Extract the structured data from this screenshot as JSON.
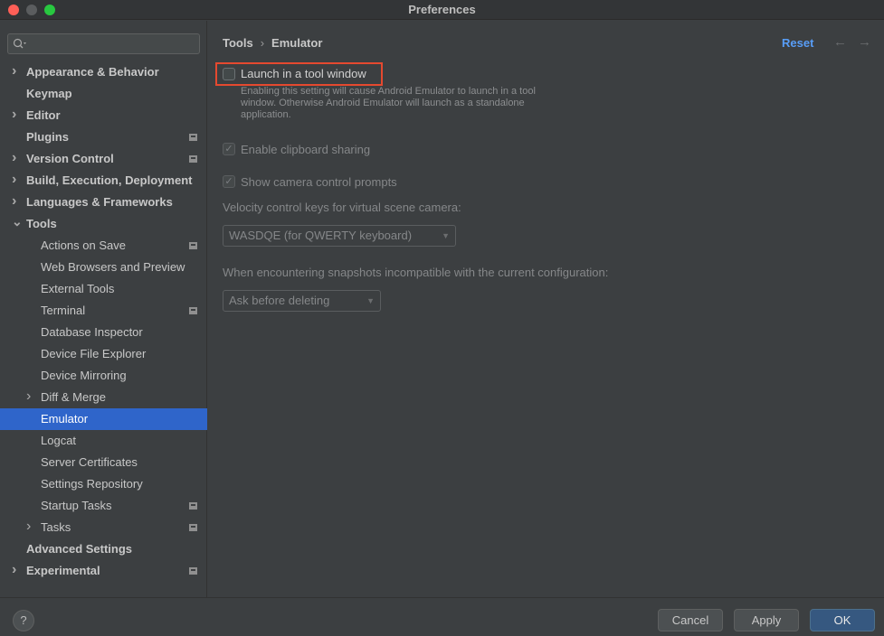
{
  "window": {
    "title": "Preferences"
  },
  "search": {
    "placeholder": ""
  },
  "tree": [
    {
      "label": "Appearance & Behavior",
      "level": 0,
      "chevron": "right",
      "bold": true,
      "project_icon": false,
      "selected": false
    },
    {
      "label": "Keymap",
      "level": 0,
      "chevron": "",
      "bold": true,
      "project_icon": false,
      "selected": false
    },
    {
      "label": "Editor",
      "level": 0,
      "chevron": "right",
      "bold": true,
      "project_icon": false,
      "selected": false
    },
    {
      "label": "Plugins",
      "level": 0,
      "chevron": "",
      "bold": true,
      "project_icon": true,
      "selected": false
    },
    {
      "label": "Version Control",
      "level": 0,
      "chevron": "right",
      "bold": true,
      "project_icon": true,
      "selected": false
    },
    {
      "label": "Build, Execution, Deployment",
      "level": 0,
      "chevron": "right",
      "bold": true,
      "project_icon": false,
      "selected": false
    },
    {
      "label": "Languages & Frameworks",
      "level": 0,
      "chevron": "right",
      "bold": true,
      "project_icon": false,
      "selected": false
    },
    {
      "label": "Tools",
      "level": 0,
      "chevron": "down",
      "bold": true,
      "project_icon": false,
      "selected": false
    },
    {
      "label": "Actions on Save",
      "level": 1,
      "chevron": "",
      "bold": false,
      "project_icon": true,
      "selected": false
    },
    {
      "label": "Web Browsers and Preview",
      "level": 1,
      "chevron": "",
      "bold": false,
      "project_icon": false,
      "selected": false
    },
    {
      "label": "External Tools",
      "level": 1,
      "chevron": "",
      "bold": false,
      "project_icon": false,
      "selected": false
    },
    {
      "label": "Terminal",
      "level": 1,
      "chevron": "",
      "bold": false,
      "project_icon": true,
      "selected": false
    },
    {
      "label": "Database Inspector",
      "level": 1,
      "chevron": "",
      "bold": false,
      "project_icon": false,
      "selected": false
    },
    {
      "label": "Device File Explorer",
      "level": 1,
      "chevron": "",
      "bold": false,
      "project_icon": false,
      "selected": false
    },
    {
      "label": "Device Mirroring",
      "level": 1,
      "chevron": "",
      "bold": false,
      "project_icon": false,
      "selected": false
    },
    {
      "label": "Diff & Merge",
      "level": 1,
      "chevron": "right",
      "bold": false,
      "project_icon": false,
      "selected": false
    },
    {
      "label": "Emulator",
      "level": 1,
      "chevron": "",
      "bold": false,
      "project_icon": false,
      "selected": true
    },
    {
      "label": "Logcat",
      "level": 1,
      "chevron": "",
      "bold": false,
      "project_icon": false,
      "selected": false
    },
    {
      "label": "Server Certificates",
      "level": 1,
      "chevron": "",
      "bold": false,
      "project_icon": false,
      "selected": false
    },
    {
      "label": "Settings Repository",
      "level": 1,
      "chevron": "",
      "bold": false,
      "project_icon": false,
      "selected": false
    },
    {
      "label": "Startup Tasks",
      "level": 1,
      "chevron": "",
      "bold": false,
      "project_icon": true,
      "selected": false
    },
    {
      "label": "Tasks",
      "level": 1,
      "chevron": "right",
      "bold": false,
      "project_icon": true,
      "selected": false
    },
    {
      "label": "Advanced Settings",
      "level": 0,
      "chevron": "",
      "bold": true,
      "project_icon": false,
      "selected": false
    },
    {
      "label": "Experimental",
      "level": 0,
      "chevron": "right",
      "bold": true,
      "project_icon": true,
      "selected": false
    }
  ],
  "breadcrumb": {
    "parent": "Tools",
    "separator": "›",
    "current": "Emulator"
  },
  "header": {
    "reset_label": "Reset",
    "back_icon": "arrow-left-icon",
    "forward_icon": "arrow-right-icon"
  },
  "settings": {
    "launch_tool_window": {
      "label": "Launch in a tool window",
      "checked": false,
      "description": "Enabling this setting will cause Android Emulator to launch in a tool window. Otherwise Android Emulator will launch as a standalone application."
    },
    "clipboard_sharing": {
      "label": "Enable clipboard sharing",
      "checked": true,
      "enabled": false
    },
    "camera_prompts": {
      "label": "Show camera control prompts",
      "checked": true,
      "enabled": false
    },
    "velocity_keys": {
      "label": "Velocity control keys for virtual scene camera:",
      "value": "WASDQE (for QWERTY keyboard)"
    },
    "snapshots": {
      "label": "When encountering snapshots incompatible with the current configuration:",
      "value": "Ask before deleting"
    }
  },
  "footer": {
    "help_label": "?",
    "cancel_label": "Cancel",
    "apply_label": "Apply",
    "ok_label": "OK"
  },
  "colors": {
    "accent": "#2f65ca",
    "link": "#589df6",
    "highlight_border": "#e5492f",
    "primary_button": "#365880"
  }
}
